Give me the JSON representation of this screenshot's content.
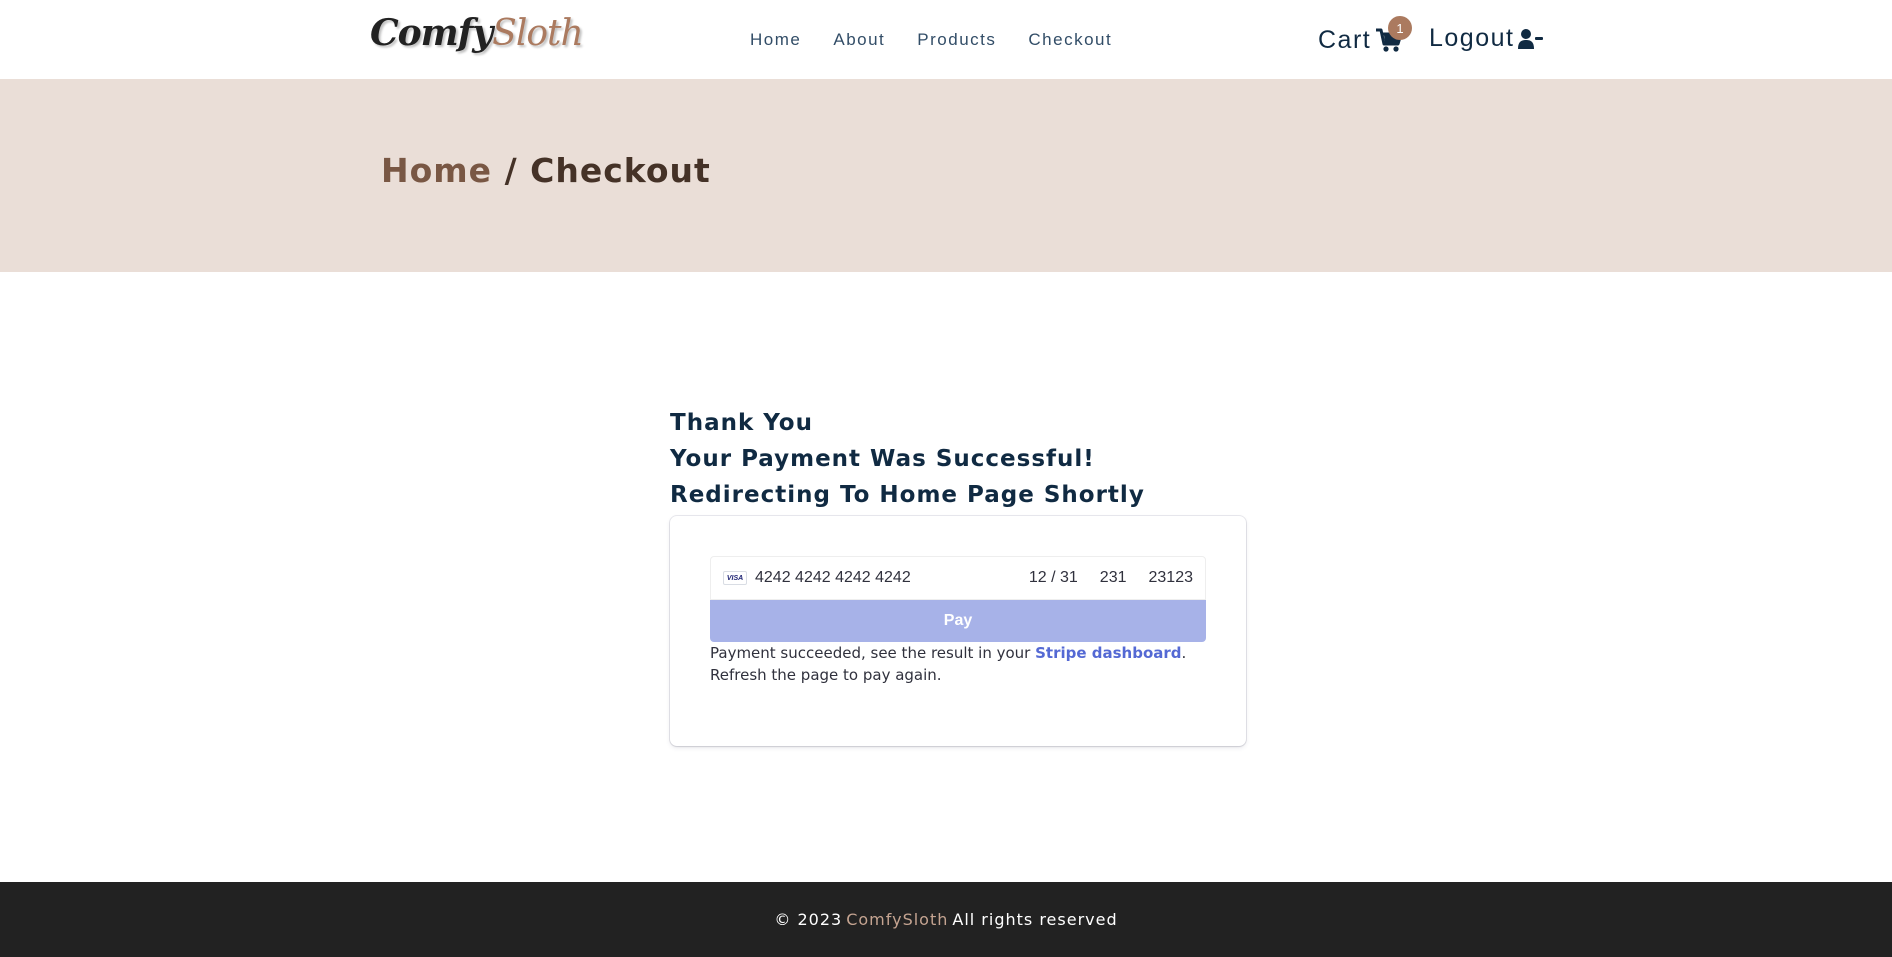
{
  "nav": {
    "logo_part1": "Comfy",
    "logo_part2": "Sloth",
    "links": [
      "Home",
      "About",
      "Products",
      "Checkout"
    ],
    "cart_label": "Cart",
    "cart_count": "1",
    "logout_label": "Logout"
  },
  "hero": {
    "home": "Home",
    "current": "/ Checkout"
  },
  "message": {
    "line1": "Thank You",
    "line2": "Your Payment Was Successful!",
    "line3": "Redirecting To Home Page Shortly"
  },
  "payment": {
    "card_brand": "VISA",
    "card_number": "4242 4242 4242 4242",
    "expiry": "12 / 31",
    "cvc": "231",
    "zip": "23123",
    "pay_label": "Pay",
    "result_pre": "Payment succeeded, see the result in your ",
    "result_link": "Stripe dashboard",
    "result_post": ". Refresh the page to pay again."
  },
  "footer": {
    "copyright": "© 2023",
    "brand": "ComfySloth",
    "rights": "All rights reserved"
  },
  "colors": {
    "brand": "#ab7a5f",
    "hero_bg": "#eaded7",
    "pay_button": "#a7b2e8",
    "footer_bg": "#222222"
  },
  "icons": [
    "cart-icon",
    "user-minus-icon"
  ]
}
